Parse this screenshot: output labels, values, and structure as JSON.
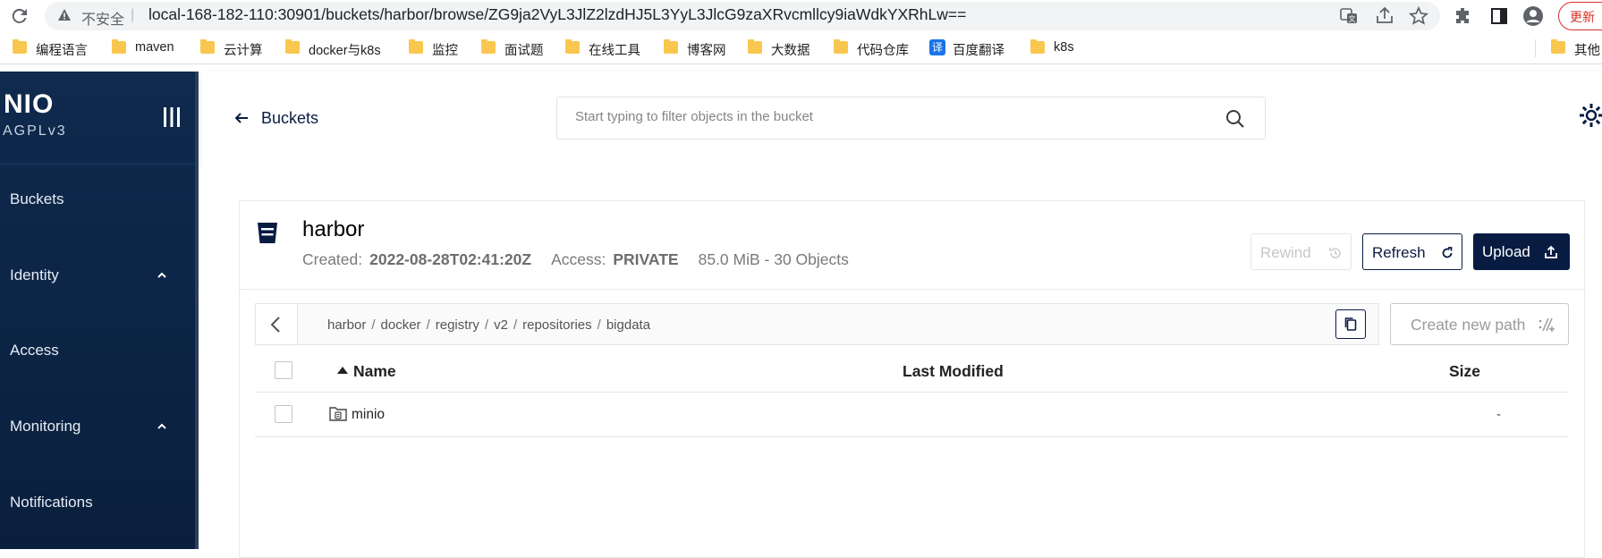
{
  "browser": {
    "insecure_label": "不安全",
    "url": "local-168-182-110:30901/buckets/harbor/browse/ZG9ja2VyL3JlZ2lzdHJ5L3YyL3JlcG9zaXRvcmllcy9iaWdkYXRhLw==",
    "update_label": "更新",
    "bookmarks": [
      {
        "label": "编程语言"
      },
      {
        "label": "maven"
      },
      {
        "label": "云计算"
      },
      {
        "label": "docker与k8s"
      },
      {
        "label": "监控"
      },
      {
        "label": "面试题"
      },
      {
        "label": "在线工具"
      },
      {
        "label": "博客网"
      },
      {
        "label": "大数据"
      },
      {
        "label": "代码仓库"
      },
      {
        "label": "百度翻译",
        "badge": "译"
      },
      {
        "label": "k8s"
      },
      {
        "label": "其他"
      }
    ]
  },
  "sidebar": {
    "logo": "NIO",
    "license": "AGPLv3",
    "items": [
      {
        "label": "Buckets"
      },
      {
        "label": "Identity"
      },
      {
        "label": "Access"
      },
      {
        "label": "Monitoring"
      },
      {
        "label": "Notifications"
      }
    ]
  },
  "topbar": {
    "back_label": "Buckets",
    "search_placeholder": "Start typing to filter objects in the bucket"
  },
  "bucket": {
    "name": "harbor",
    "created_label": "Created:",
    "created_value": "2022-08-28T02:41:20Z",
    "access_label": "Access:",
    "access_value": "PRIVATE",
    "usage": "85.0 MiB - 30 Objects",
    "buttons": {
      "rewind": "Rewind",
      "refresh": "Refresh",
      "upload": "Upload"
    }
  },
  "breadcrumb": {
    "parts": [
      "harbor",
      "docker",
      "registry",
      "v2",
      "repositories",
      "bigdata"
    ],
    "separator": "/"
  },
  "create_path_label": "Create new path",
  "table": {
    "columns": {
      "name": "Name",
      "modified": "Last Modified",
      "size": "Size"
    },
    "rows": [
      {
        "name": "minio",
        "modified": "",
        "size": "-"
      }
    ]
  },
  "colors": {
    "brand_navy": "#081c42",
    "sidebar_bg": "#0f2a4e",
    "update_red": "#d93025"
  }
}
